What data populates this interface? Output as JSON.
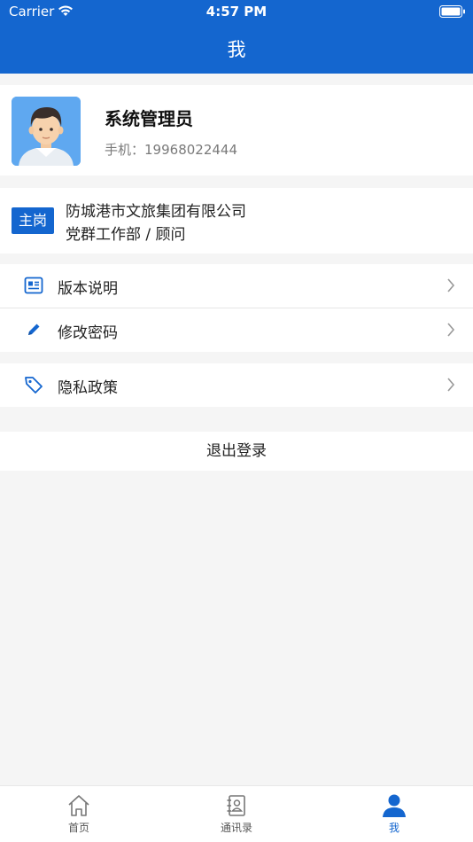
{
  "status_bar": {
    "carrier": "Carrier",
    "time": "4:57 PM"
  },
  "nav": {
    "title": "我"
  },
  "profile": {
    "name": "系统管理员",
    "phone_label": "手机：",
    "phone": "19968022444"
  },
  "post": {
    "badge": "主岗",
    "company": "防城港市文旅集团有限公司",
    "department": "党群工作部 / 顾问"
  },
  "menu": {
    "group1": [
      {
        "label": "版本说明",
        "icon": "document-icon"
      },
      {
        "label": "修改密码",
        "icon": "pencil-icon"
      }
    ],
    "group2": [
      {
        "label": "隐私政策",
        "icon": "tag-icon"
      }
    ]
  },
  "logout": {
    "label": "退出登录"
  },
  "tabbar": {
    "tabs": [
      {
        "label": "首页",
        "icon": "home-icon",
        "active": false
      },
      {
        "label": "通讯录",
        "icon": "contacts-icon",
        "active": false
      },
      {
        "label": "我",
        "icon": "person-icon",
        "active": true
      }
    ]
  },
  "colors": {
    "primary": "#1466cf",
    "background": "#f5f5f5"
  }
}
